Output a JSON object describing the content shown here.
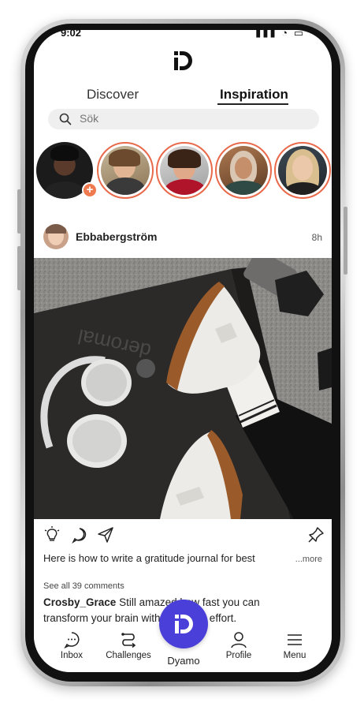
{
  "statusbar": {
    "time": "9:02",
    "icons": "▮▮▮ ◔ ▭"
  },
  "tabs": [
    {
      "label": "Discover",
      "active": false
    },
    {
      "label": "Inspiration",
      "active": true
    }
  ],
  "search": {
    "placeholder": "Sök"
  },
  "stories": [
    {
      "name": "me",
      "has_add": true,
      "ring": false
    },
    {
      "name": "story-2",
      "ring": true
    },
    {
      "name": "story-3",
      "ring": true
    },
    {
      "name": "story-4",
      "ring": true
    },
    {
      "name": "story-5",
      "ring": true
    }
  ],
  "post": {
    "username": "Ebbabergström",
    "time": "8h",
    "image_alt_icon": "sneakers-headphones-photo",
    "caption": "Here is how to write a gratitude journal for best",
    "more": "...more",
    "see_all": "See all 39 comments",
    "comment_user": "Crosby_Grace",
    "comment_text": " Still amazed how fast you can transform your brain with minimum effort."
  },
  "nav": {
    "inbox": "Inbox",
    "challenges": "Challenges",
    "center": "Dyamo",
    "profile": "Profile",
    "menu": "Menu"
  },
  "colors": {
    "accent": "#4a3fd8",
    "story_ring": "#e96a4a",
    "add_badge": "#f07a4f"
  }
}
